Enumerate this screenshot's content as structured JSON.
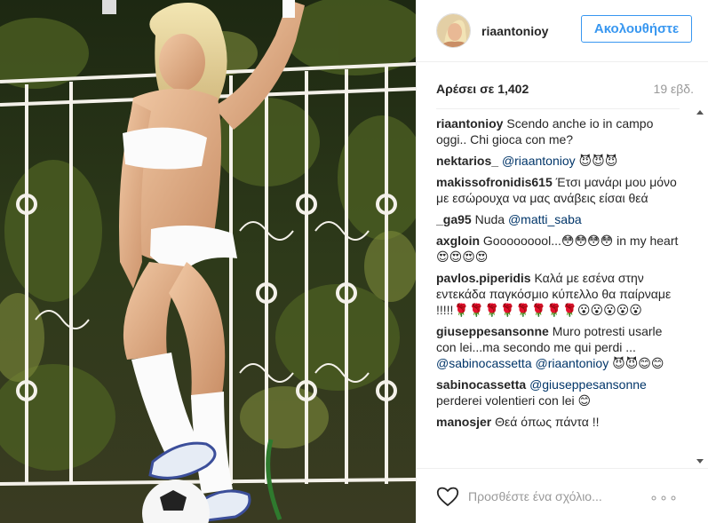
{
  "post": {
    "username": "riaantonioy",
    "follow_label": "Ακολουθήστε",
    "likes_label": "Αρέσει σε 1,402",
    "time_label": "19 εβδ.",
    "add_comment_placeholder": "Προσθέστε ένα σχόλιο...",
    "more_label": "∘∘∘",
    "icons": {
      "like": "heart-icon",
      "more": "more-options-icon"
    },
    "colors": {
      "accent": "#3897f0",
      "mention": "#003569",
      "muted": "#999999"
    }
  },
  "comments": [
    {
      "author": "riaantonioy",
      "text": "Scendo anche io in campo oggi.. Chi gioca con me?",
      "mention": "",
      "tail": ""
    },
    {
      "author": "nektarios_",
      "text": "",
      "mention": "@riaantonioy",
      "tail": " 😈😈😈"
    },
    {
      "author": "makissofronidis615",
      "text": "Έτσι μανάρι μου μόνο με εσώρουχα να μας ανάβεις είσαι θεά",
      "mention": "",
      "tail": ""
    },
    {
      "author": "_ga95",
      "text": "Nuda",
      "mention": "@matti_saba",
      "tail": ""
    },
    {
      "author": "axgloin",
      "text": "Gooooooool...😳😳😳😳 in my heart 😍😍😍😍",
      "mention": "",
      "tail": ""
    },
    {
      "author": "pavlos.piperidis",
      "text": "Καλά με εσένα στην εντεκάδα παγκόσμιο κύπελλο θα παίρναμε !!!!!🌹🌹🌹🌹🌹🌹🌹🌹😮😮😮😮😮",
      "mention": "",
      "tail": ""
    },
    {
      "author": "giuseppesansonne",
      "text": "Muro potresti usarle con lei...ma secondo me qui perdi ...",
      "mention": "@sabinocassetta @riaantonioy",
      "tail": " 😈😈😊😊"
    },
    {
      "author": "sabinocassetta",
      "text": "",
      "mention": "@giuseppesansonne",
      "tail": " perderei volentieri con lei 😊"
    },
    {
      "author": "manosjer",
      "text": "Θεά όπως πάντα !!",
      "mention": "",
      "tail": ""
    }
  ]
}
